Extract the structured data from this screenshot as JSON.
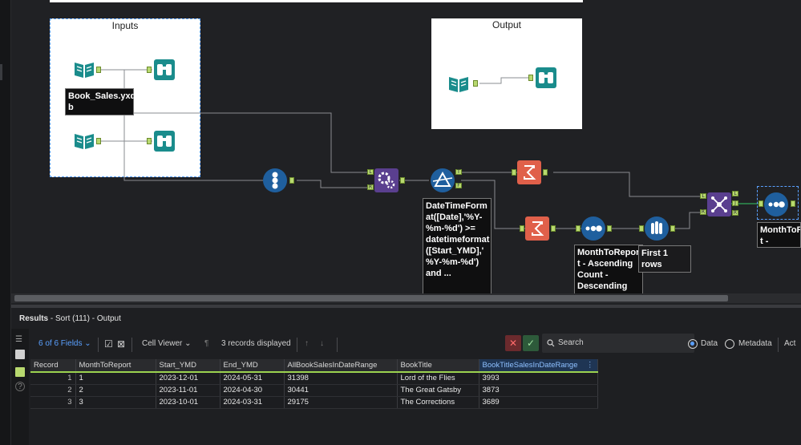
{
  "canvas": {
    "containers": [
      {
        "title": "Inputs"
      },
      {
        "title": "Output"
      }
    ],
    "annotations": {
      "input_file": "Book_Sales.yxd\nb",
      "filter_expr": "DateTimeForm\nat([Date],'%Y-\n%m-%d') >=\ndatetimeformat\n([Start_YMD],'\n%Y-%m-%d')\nand ...",
      "sort_desc": "MonthToRepor\nt - Ascending\nCount -\nDescending",
      "sample_desc": "First 1 rows",
      "sort_right": "MonthToR\nt - Ascendi"
    },
    "anchor_labels": {
      "T": "T",
      "F": "F",
      "L": "L",
      "J": "J",
      "R": "R"
    }
  },
  "results": {
    "title_bold": "Results",
    "title_rest": " - Sort (111) - Output",
    "toolbar": {
      "fields": "6 of 6 Fields",
      "cell_viewer": "Cell Viewer",
      "records": "3 records displayed",
      "search_placeholder": "Search",
      "data_label": "Data",
      "metadata_label": "Metadata",
      "actions_label": "Act"
    },
    "columns": [
      "Record",
      "MonthToReport",
      "Start_YMD",
      "End_YMD",
      "AllBookSalesInDateRange",
      "BookTitle",
      "BookTitleSalesInDateRange"
    ],
    "rows": [
      [
        "1",
        "1",
        "2023-12-01",
        "2024-05-31",
        "31398",
        "Lord of the Flies",
        "3993"
      ],
      [
        "2",
        "2",
        "2023-11-01",
        "2024-04-30",
        "30441",
        "The Great Gatsby",
        "3873"
      ],
      [
        "3",
        "3",
        "2023-10-01",
        "2024-03-31",
        "29175",
        "The Corrections",
        "3689"
      ]
    ]
  },
  "colors": {
    "canvas_bg": "#202124",
    "input_tool": "#1a8c8c",
    "record_id_tool": "#1f5f9e",
    "formula_tool": "#5a3f8f",
    "filter_tool": "#1f5f9e",
    "summarize_tool": "#e0604a",
    "accent_green": "#9bd24f",
    "accent_blue": "#5aa0ff"
  }
}
